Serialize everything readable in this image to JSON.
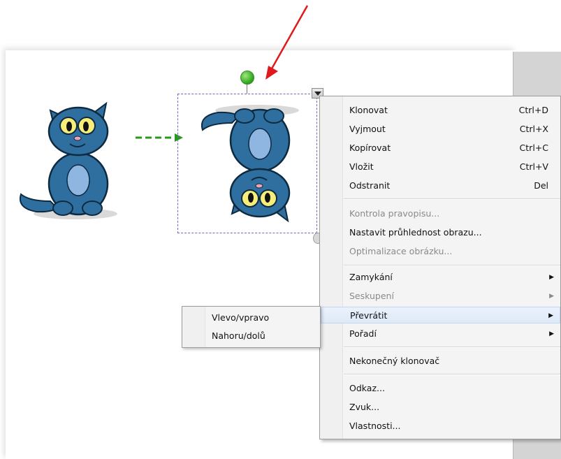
{
  "context_menu": {
    "items": [
      {
        "label": "Klonovat",
        "shortcut": "Ctrl+D"
      },
      {
        "label": "Vyjmout",
        "shortcut": "Ctrl+X"
      },
      {
        "label": "Kopírovat",
        "shortcut": "Ctrl+C"
      },
      {
        "label": "Vložit",
        "shortcut": "Ctrl+V"
      },
      {
        "label": "Odstranit",
        "shortcut": "Del"
      },
      {
        "label": "Kontrola pravopisu..."
      },
      {
        "label": "Nastavit průhlednost obrazu..."
      },
      {
        "label": "Optimalizace obrázku..."
      },
      {
        "label": "Zamykání"
      },
      {
        "label": "Seskupení"
      },
      {
        "label": "Převrátit"
      },
      {
        "label": "Pořadí"
      },
      {
        "label": "Nekonečný klonovač"
      },
      {
        "label": "Odkaz..."
      },
      {
        "label": "Zvuk..."
      },
      {
        "label": "Vlastnosti..."
      }
    ]
  },
  "submenu": {
    "items": [
      {
        "label": "Vlevo/vpravo"
      },
      {
        "label": "Nahoru/dolů"
      }
    ]
  },
  "colors": {
    "annotation_arrow": "#e0191c",
    "dashed_arrow": "#2a9a1a",
    "rotation_handle": "#3cb32a",
    "selection_border": "#6a6ad0",
    "cat_body": "#2f6f9f"
  },
  "icons": [
    "rotation-handle-icon",
    "object-menu-dropdown-icon",
    "submenu-arrow-icon",
    "resize-handle-icon"
  ]
}
